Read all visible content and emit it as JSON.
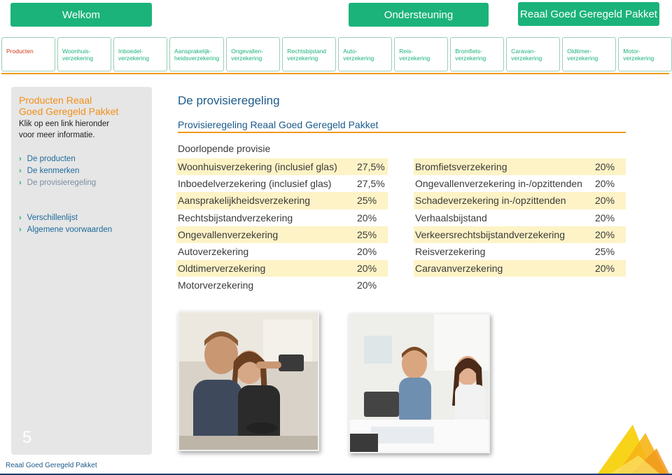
{
  "header": {
    "welkom": "Welkom",
    "ondersteuning": "Ondersteuning",
    "pakket": "Reaal Goed Geregeld Pakket"
  },
  "tabs": [
    {
      "line1": "Producten",
      "line2": ""
    },
    {
      "line1": "Woonhuis-",
      "line2": "verzekering"
    },
    {
      "line1": "Inboedel-",
      "line2": "verzekering"
    },
    {
      "line1": "Aansprakelijk-",
      "line2": "heidsverzekering"
    },
    {
      "line1": "Ongevallen-",
      "line2": "verzekering"
    },
    {
      "line1": "Rechtsbijstand",
      "line2": "verzekering"
    },
    {
      "line1": "Auto-",
      "line2": "verzekering"
    },
    {
      "line1": "Reis-",
      "line2": "verzekering"
    },
    {
      "line1": "Bromfiets-",
      "line2": "verzekering"
    },
    {
      "line1": "Caravan-",
      "line2": "verzekering"
    },
    {
      "line1": "Oldtimer-",
      "line2": "verzekering"
    },
    {
      "line1": "Motor-",
      "line2": "verzekering"
    }
  ],
  "sidebar": {
    "title_line1": "Producten Reaal",
    "title_line2": "Goed Geregeld Pakket",
    "desc_line1": "Klik op een link hieronder",
    "desc_line2": "voor meer informatie.",
    "links": [
      "De producten",
      "De kenmerken",
      "De provisieregeling"
    ],
    "links2": [
      "Verschillenlijst",
      "Algemene voorwaarden"
    ],
    "page_number": "5"
  },
  "main": {
    "title": "De provisieregeling",
    "subtitle": "Provisieregeling Reaal Goed Geregeld Pakket",
    "section_label": "Doorlopende provisie",
    "rates_left": [
      {
        "name": "Woonhuisverzekering (inclusief glas)",
        "pct": "27,5%"
      },
      {
        "name": "Inboedelverzekering (inclusief glas)",
        "pct": "27,5%"
      },
      {
        "name": "Aansprakelijkheidsverzekering",
        "pct": "25%"
      },
      {
        "name": "Rechtsbijstandverzekering",
        "pct": "20%"
      },
      {
        "name": "Ongevallenverzekering",
        "pct": "25%"
      },
      {
        "name": "Autoverzekering",
        "pct": "20%"
      },
      {
        "name": "Oldtimerverzekering",
        "pct": "20%"
      },
      {
        "name": "Motorverzekering",
        "pct": "20%"
      }
    ],
    "rates_right": [
      {
        "name": "Bromfietsverzekering",
        "pct": "20%"
      },
      {
        "name": "Ongevallenverzekering in-/opzittenden",
        "pct": "20%"
      },
      {
        "name": "Schadeverzekering in-/opzittenden",
        "pct": "20%"
      },
      {
        "name": "Verhaalsbijstand",
        "pct": "20%"
      },
      {
        "name": "Verkeersrechtsbijstandverzekering",
        "pct": "20%"
      },
      {
        "name": "Reisverzekering",
        "pct": "25%"
      },
      {
        "name": "Caravanverzekering",
        "pct": "20%"
      }
    ]
  },
  "footer": {
    "text": "Reaal Goed Geregeld Pakket"
  },
  "colors": {
    "green": "#1bb37a",
    "orange": "#f29a1b",
    "blue": "#1d5a8a",
    "highlight": "#fdf3c6"
  }
}
